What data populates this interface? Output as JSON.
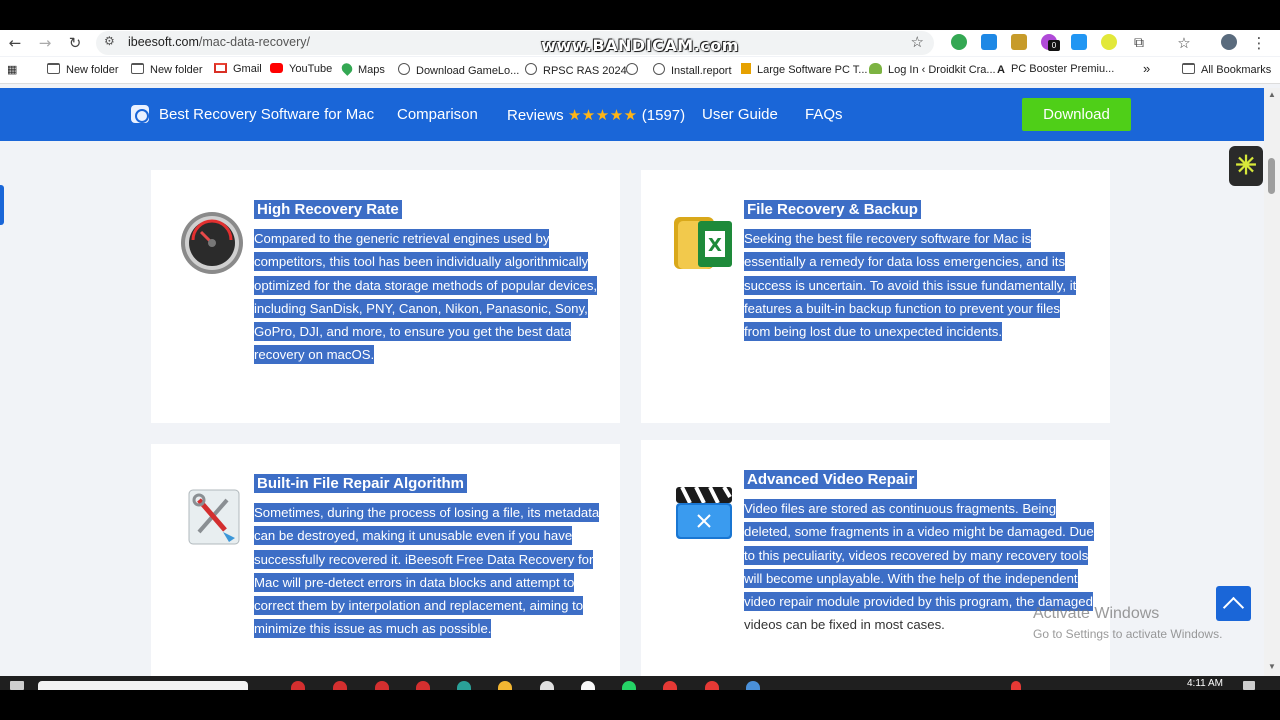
{
  "watermark": "www.BANDICAM.com",
  "browser": {
    "url_host": "ibeesoft.com",
    "url_path": "/mac-data-recovery/",
    "ext_badge": "0",
    "bookmarks": [
      {
        "label": "New folder",
        "icon": "folder-icon"
      },
      {
        "label": "New folder",
        "icon": "folder-icon"
      },
      {
        "label": "Gmail",
        "icon": "gmail-icon"
      },
      {
        "label": "YouTube",
        "icon": "youtube-icon"
      },
      {
        "label": "Maps",
        "icon": "maps-icon"
      },
      {
        "label": "Download GameLo...",
        "icon": "globe-icon"
      },
      {
        "label": "RPSC RAS 2024",
        "icon": "globe-icon"
      },
      {
        "label": "Install.report",
        "icon": "globe-icon"
      },
      {
        "label": "Large Software PC T...",
        "icon": "site-icon"
      },
      {
        "label": "Log In ‹ Droidkit Cra...",
        "icon": "android-icon"
      },
      {
        "label": "PC Booster Premiu...",
        "icon": "a-icon"
      }
    ],
    "all_bookmarks": "All Bookmarks",
    "more_bookmarks": "»"
  },
  "site": {
    "nav": {
      "brand": "Best Recovery Software for Mac",
      "comparison": "Comparison",
      "reviews": "Reviews",
      "stars": "★★★★★",
      "review_count": "(1597)",
      "user_guide": "User Guide",
      "faqs": "FAQs",
      "download": "Download"
    },
    "features": [
      {
        "title": "High Recovery Rate",
        "icon": "speedometer-icon",
        "desc": "Compared to the generic retrieval engines used by competitors, this tool has been individually algorithmically optimized for the data storage methods of popular devices, including SanDisk, PNY, Canon, Nikon, Panasonic, Sony, GoPro, DJI, and more, to ensure you get the best data recovery on macOS."
      },
      {
        "title": "File Recovery & Backup",
        "icon": "folder-backup-icon",
        "desc": "Seeking the best file recovery software for Mac is essentially a remedy for data loss emergencies, and its success is uncertain. To avoid this issue fundamentally, it features a built-in backup function to prevent your files from being lost due to unexpected incidents."
      },
      {
        "title": "Built-in File Repair Algorithm",
        "icon": "repair-tools-icon",
        "desc": "Sometimes, during the process of losing a file, its metadata can be destroyed, making it unusable even if you have successfully recovered it. iBeesoft Free Data Recovery for Mac will pre-detect errors in data blocks and attempt to correct them by interpolation and replacement, aiming to minimize this issue as much as possible."
      },
      {
        "title": "Advanced Video Repair",
        "icon": "clapperboard-icon",
        "desc_selected": "Video files are stored as continuous fragments. Being deleted, some fragments in a video might be damaged. Due to this peculiarity, videos recovered by many recovery tools will become unplayable. With the help of the independent video repair module provided by this program, the damaged",
        "desc_rest": " videos can be fixed in most cases."
      }
    ]
  },
  "overlay": {
    "activate_title": "Activate Windows",
    "activate_sub": "Go to Settings to activate Windows."
  },
  "taskbar": {
    "time": "4:11 AM"
  }
}
